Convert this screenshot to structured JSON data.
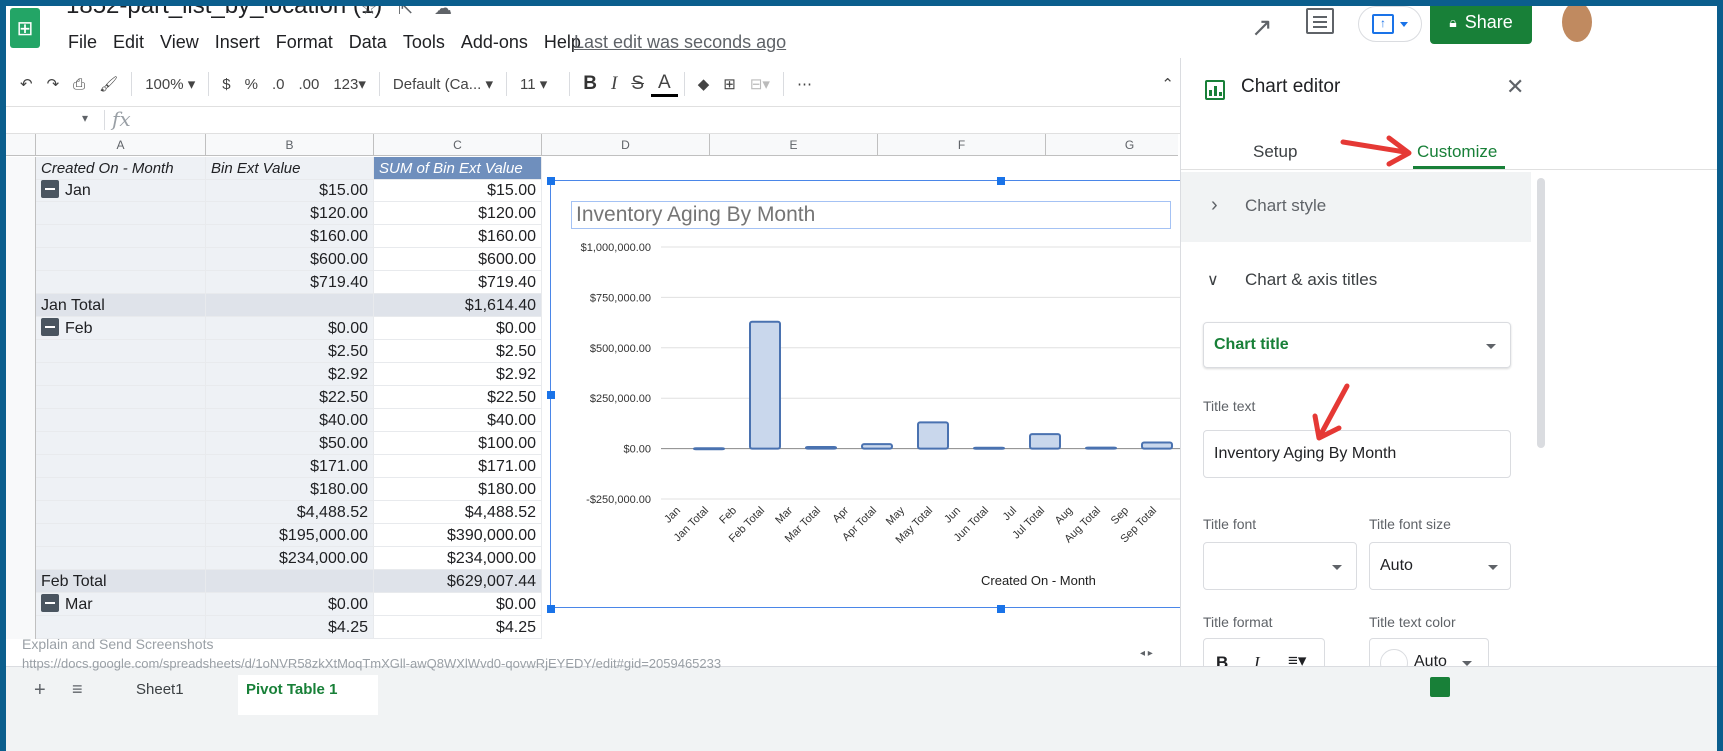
{
  "header": {
    "doc_title": "1852-part_list_by_location (1)",
    "menu": [
      "File",
      "Edit",
      "View",
      "Insert",
      "Format",
      "Data",
      "Tools",
      "Add-ons",
      "Help"
    ],
    "last_edit": "Last edit was seconds ago",
    "share_label": "Share"
  },
  "toolbar": {
    "zoom": "100% ▾",
    "currency": "$",
    "percent": "%",
    "dec_less": ".0",
    "dec_more": ".00",
    "format_more": "123▾",
    "font": "Default (Ca... ▾",
    "font_size": "11 ▾",
    "bold": "B",
    "italic": "I",
    "strike": "S",
    "text_color": "A",
    "more": "⋯"
  },
  "formula_bar": {
    "cell_ref": "▾",
    "fx": "fx",
    "value": ""
  },
  "grid": {
    "columns": [
      "A",
      "B",
      "C",
      "D",
      "E",
      "F",
      "G"
    ],
    "header_row": [
      "Created On - Month",
      "Bin Ext Value",
      "SUM of Bin Ext Value"
    ],
    "rows": [
      {
        "a": "Jan",
        "group": true,
        "b": "$15.00",
        "c": "$15.00"
      },
      {
        "a": "",
        "b": "$120.00",
        "c": "$120.00"
      },
      {
        "a": "",
        "b": "$160.00",
        "c": "$160.00"
      },
      {
        "a": "",
        "b": "$600.00",
        "c": "$600.00"
      },
      {
        "a": "",
        "b": "$719.40",
        "c": "$719.40"
      },
      {
        "a": "Jan Total",
        "total": true,
        "b": "",
        "c": "$1,614.40"
      },
      {
        "a": "Feb",
        "group": true,
        "b": "$0.00",
        "c": "$0.00"
      },
      {
        "a": "",
        "b": "$2.50",
        "c": "$2.50"
      },
      {
        "a": "",
        "b": "$2.92",
        "c": "$2.92"
      },
      {
        "a": "",
        "b": "$22.50",
        "c": "$22.50"
      },
      {
        "a": "",
        "b": "$40.00",
        "c": "$40.00"
      },
      {
        "a": "",
        "b": "$50.00",
        "c": "$100.00"
      },
      {
        "a": "",
        "b": "$171.00",
        "c": "$171.00"
      },
      {
        "a": "",
        "b": "$180.00",
        "c": "$180.00"
      },
      {
        "a": "",
        "b": "$4,488.52",
        "c": "$4,488.52"
      },
      {
        "a": "",
        "b": "$195,000.00",
        "c": "$390,000.00"
      },
      {
        "a": "",
        "b": "$234,000.00",
        "c": "$234,000.00"
      },
      {
        "a": "Feb Total",
        "total": true,
        "b": "",
        "c": "$629,007.44"
      },
      {
        "a": "Mar",
        "group": true,
        "b": "$0.00",
        "c": "$0.00"
      },
      {
        "a": "",
        "b": "$4.25",
        "c": "$4.25"
      }
    ]
  },
  "chart_data": {
    "type": "bar",
    "title": "Inventory Aging By Month",
    "xlabel": "Created On - Month",
    "ylabel": "",
    "ylim": [
      -250000,
      1000000
    ],
    "yticks": [
      "$1,000,000.00",
      "$750,000.00",
      "$500,000.00",
      "$250,000.00",
      "$0.00",
      "-$250,000.00"
    ],
    "categories": [
      "Jan",
      "Jan Total",
      "Feb",
      "Feb Total",
      "Mar",
      "Mar Total",
      "Apr",
      "Apr Total",
      "May",
      "May Total",
      "Jun",
      "Jun Total",
      "Jul",
      "Jul Total",
      "Aug",
      "Aug Total",
      "Sep",
      "Sep Total"
    ],
    "values": [
      0,
      1614,
      0,
      629007,
      0,
      8000,
      0,
      22000,
      0,
      130000,
      0,
      4000,
      0,
      72000,
      0,
      5000,
      0,
      30000
    ],
    "bar_color": "#c9d7ec",
    "bar_stroke": "#4a72b0",
    "grid": true
  },
  "panel": {
    "title": "Chart editor",
    "tab_setup": "Setup",
    "tab_customize": "Customize",
    "section_style": "Chart style",
    "section_axis": "Chart & axis titles",
    "dropdown_value": "Chart title",
    "title_text_label": "Title text",
    "title_text_value": "Inventory Aging By Month",
    "title_font_label": "Title font",
    "title_font_value": "",
    "title_font_size_label": "Title font size",
    "title_font_size_value": "Auto",
    "title_format_label": "Title format",
    "title_color_label": "Title text color",
    "title_color_value": "Auto",
    "format_bold": "B",
    "format_italic": "I"
  },
  "bottom": {
    "sheet1": "Sheet1",
    "pivot": "Pivot Table 1",
    "overlay_title": "Explain and Send Screenshots",
    "overlay_url": "https://docs.google.com/spreadsheets/d/1oNVR58zkXtMoqTmXGll-awQ8WXlWvd0-qovwRjEYEDY/edit#gid=2059465233"
  },
  "colors": {
    "green": "#188038",
    "blue": "#1a73e8",
    "arrow": "#e53935"
  }
}
